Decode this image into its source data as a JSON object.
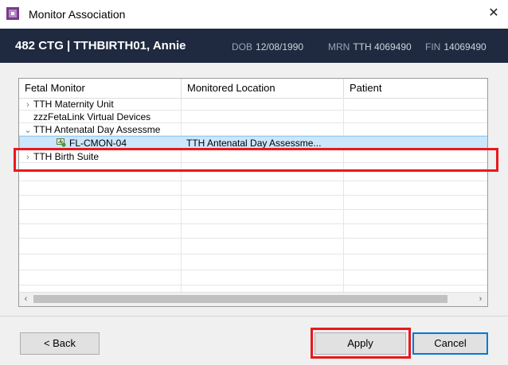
{
  "window": {
    "title": "Monitor Association",
    "close_glyph": "✕"
  },
  "banner": {
    "name": "482 CTG | TTHBIRTH01, Annie",
    "dob_label": "DOB",
    "dob": "12/08/1990",
    "mrn_label": "MRN",
    "mrn": "TTH 4069490",
    "fin_label": "FIN",
    "fin": "14069490"
  },
  "grid": {
    "columns": [
      "Fetal Monitor",
      "Monitored Location",
      "Patient"
    ],
    "rows": [
      {
        "expander": "›",
        "monitor": "TTH Maternity Unit",
        "location": "",
        "patient": ""
      },
      {
        "expander": "",
        "monitor": "zzzFetaLink Virtual Devices",
        "location": "",
        "patient": ""
      },
      {
        "expander": "⌄",
        "monitor": "TTH Antenatal Day Assessme",
        "location": "",
        "patient": ""
      },
      {
        "expander": "",
        "monitor": "FL-CMON-04",
        "location": "TTH Antenatal Day Assessme...",
        "patient": "",
        "icon": "monitor-device-icon",
        "selected": true
      },
      {
        "expander": "›",
        "monitor": "TTH Birth Suite",
        "location": "",
        "patient": ""
      }
    ],
    "scroll_left": "‹",
    "scroll_right": "›"
  },
  "buttons": {
    "back": "< Back",
    "apply": "Apply",
    "cancel": "Cancel"
  },
  "colors": {
    "banner_bg": "#1f2a40",
    "highlight": "#e8191b",
    "selection": "#cce6fb",
    "accent": "#0078d7"
  }
}
